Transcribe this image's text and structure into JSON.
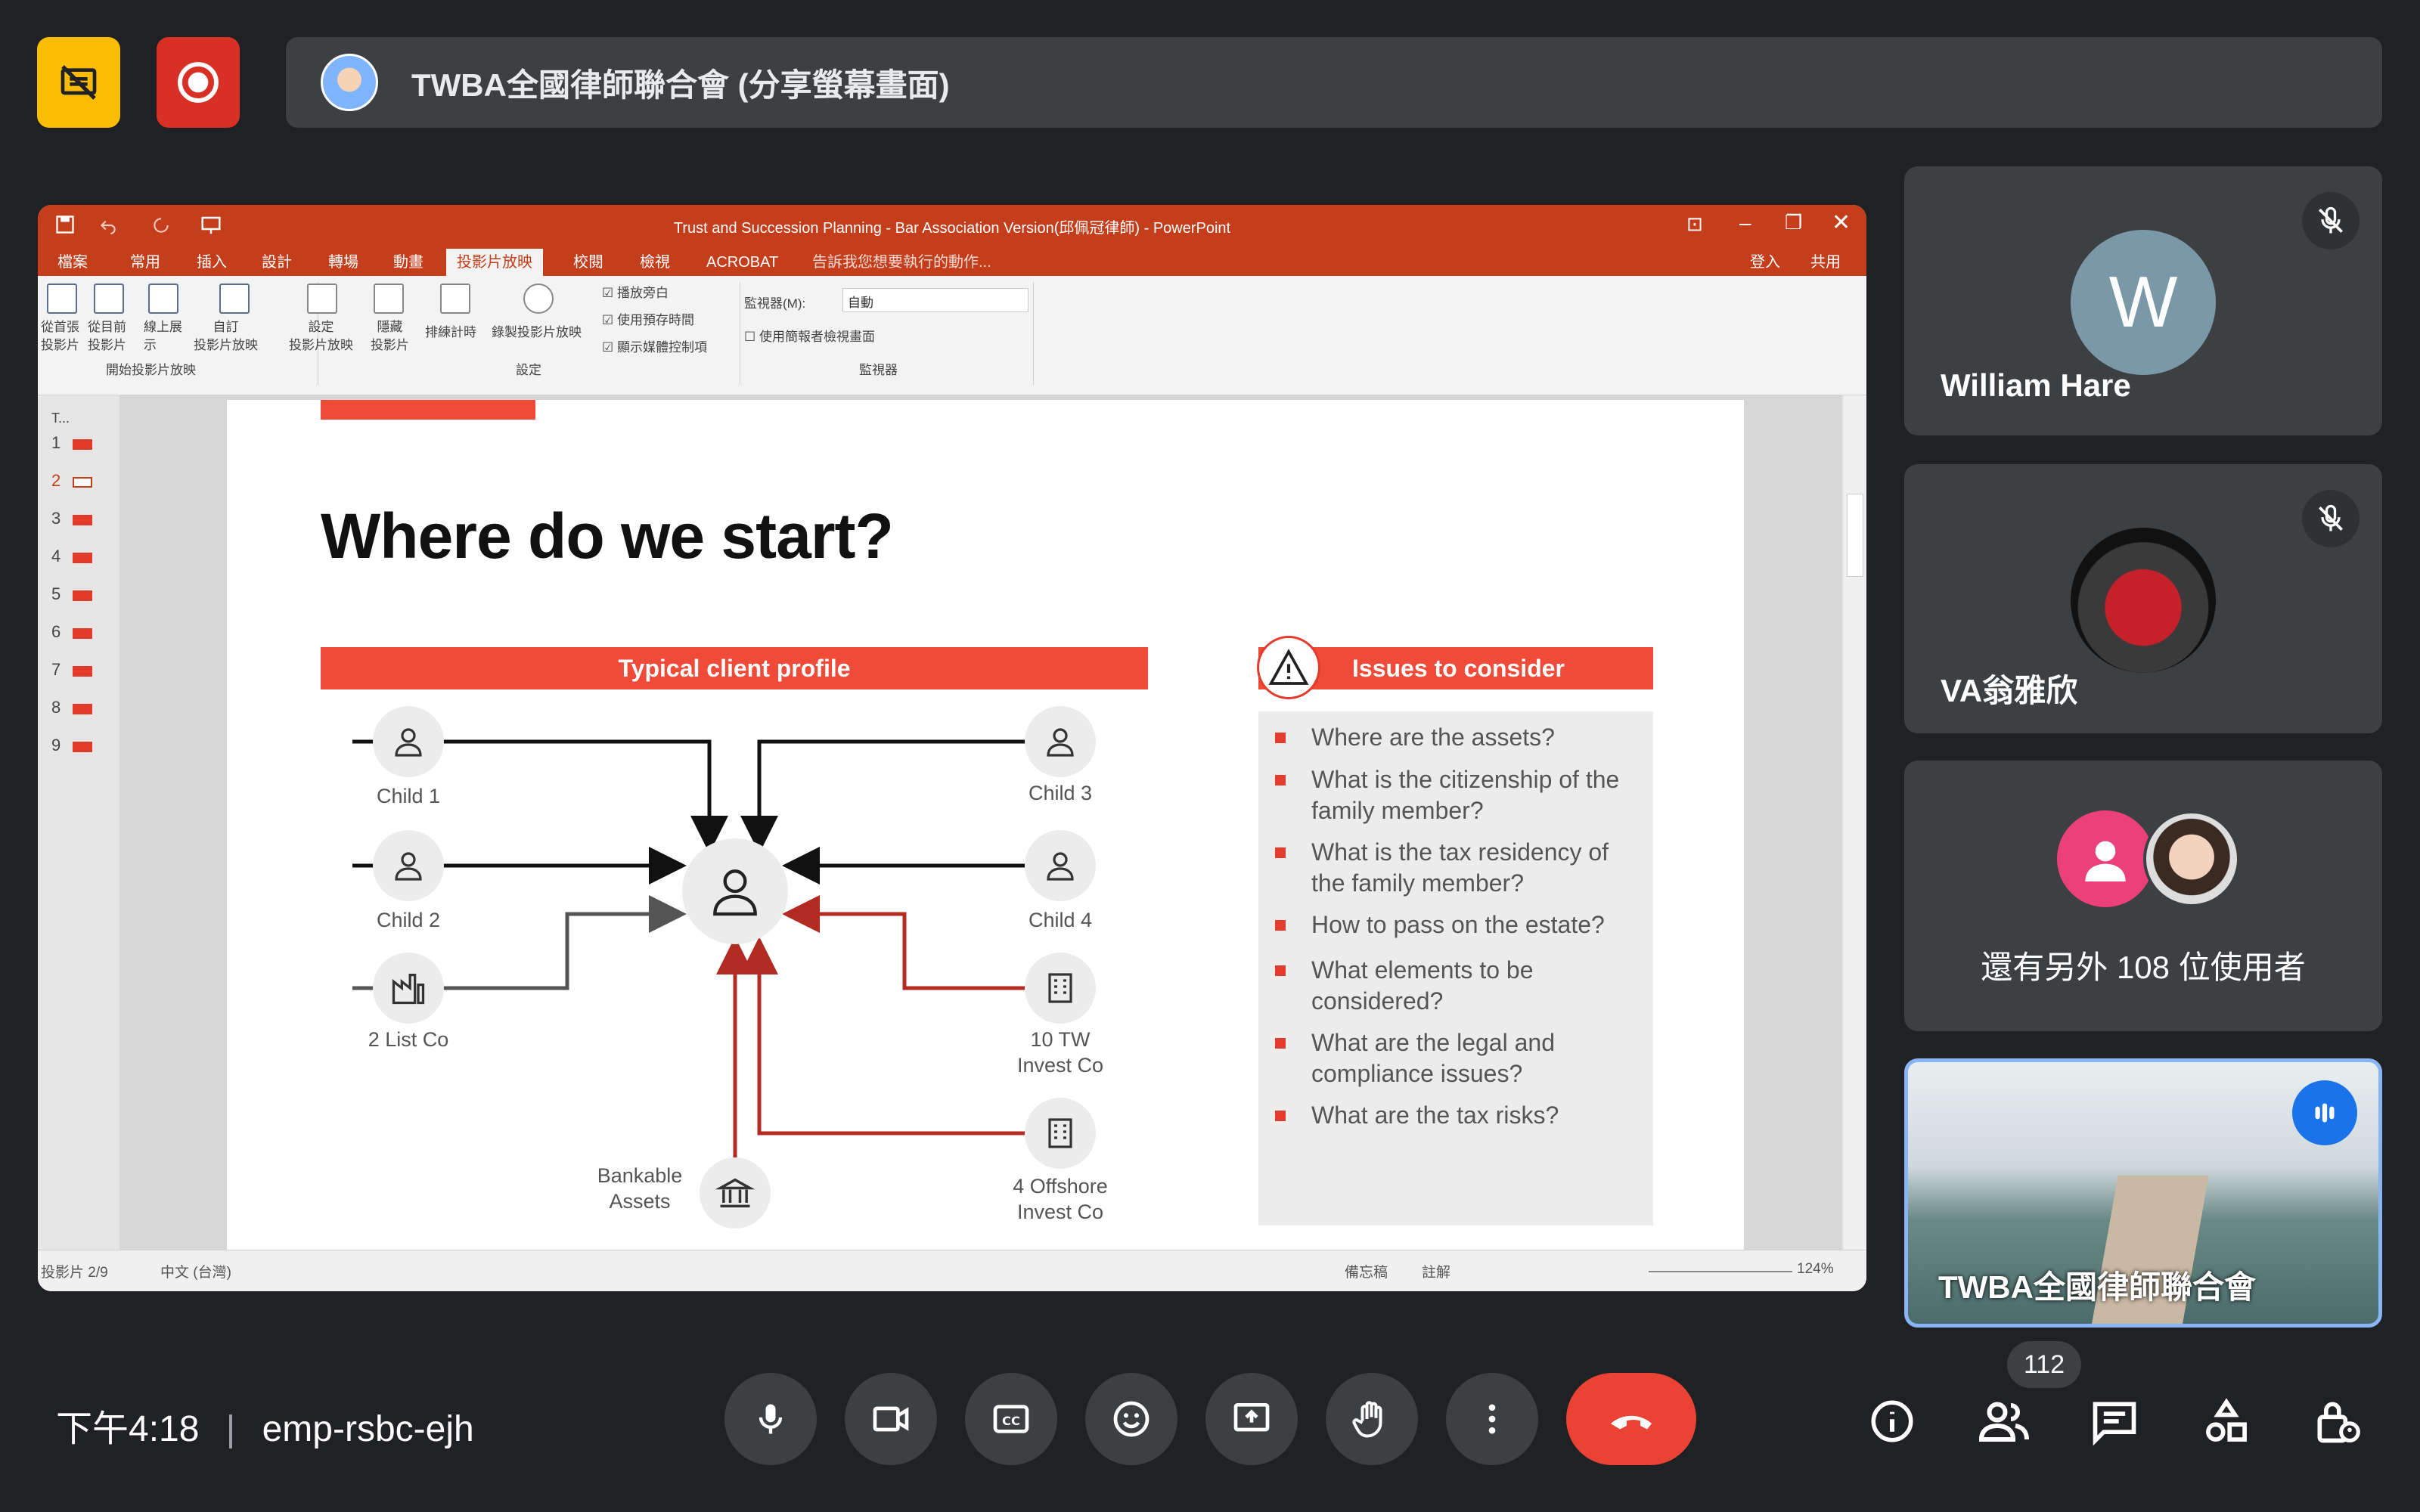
{
  "meeting": {
    "title": "TWBA全國律師聯合會 (分享螢幕畫面)",
    "time": "下午4:18",
    "code": "emp-rsbc-ejh",
    "participant_count": "112"
  },
  "ppt": {
    "window_title": "Trust and Succession Planning - Bar Association Version(邱佩冠律師) - PowerPoint",
    "tabs": [
      "檔案",
      "常用",
      "插入",
      "設計",
      "轉場",
      "動畫",
      "投影片放映",
      "校閱",
      "檢視",
      "ACROBAT"
    ],
    "active_tab": "投影片放映",
    "tell_me": "告訴我您想要執行的動作...",
    "sign_in": "登入",
    "share": "共用",
    "ribbon": {
      "from_beginning": "從首張\n投影片",
      "from_current": "從目前\n投影片",
      "online": "線上展\n示",
      "custom": "自訂\n投影片放映",
      "group_start": "開始投影片放映",
      "setup": "設定\n投影片放映",
      "hide": "隱藏\n投影片",
      "rehearse": "排練計時",
      "record": "錄製投影片放映",
      "group_setup": "設定",
      "play_narrations": "播放旁白",
      "use_timings": "使用預存時間",
      "show_media_controls": "顯示媒體控制項",
      "monitor_label": "監視器(M):",
      "monitor_value": "自動",
      "presenter_view": "使用簡報者檢視畫面",
      "group_monitors": "監視器"
    },
    "thumbnails": [
      "1",
      "2",
      "3",
      "4",
      "5",
      "6",
      "7",
      "8",
      "9"
    ],
    "outline_header": "T...",
    "status": {
      "slide_pos": "投影片 2/9",
      "language": "中文 (台灣)",
      "notes": "備忘稿",
      "comments": "註解",
      "zoom": "124%"
    }
  },
  "slide": {
    "heading": "Where do we start?",
    "profile_header": "Typical client profile",
    "issues_header": "Issues to consider",
    "nodes": {
      "child1": "Child 1",
      "child2": "Child 2",
      "list_co": "2 List Co",
      "child3": "Child 3",
      "child4": "Child 4",
      "tw_invest": "10 TW\nInvest Co",
      "offshore": "4 Offshore\nInvest Co",
      "bank": "Bankable\nAssets"
    },
    "issues": [
      "Where are the assets?",
      "What is the citizenship of the family member?",
      "What is the tax residency of the family member?",
      "How to pass on the estate?",
      "What elements to be considered?",
      "What are the legal and compliance issues?",
      "What are the tax risks?"
    ]
  },
  "tiles": {
    "william": {
      "initial": "W",
      "name": "William Hare"
    },
    "va": {
      "name": "VA翁雅欣"
    },
    "others": {
      "text": "還有另外 108 位使用者"
    },
    "room": {
      "name": "TWBA全國律師聯合會"
    }
  },
  "colors": {
    "accent_red": "#ea4335",
    "ppt_orange": "#c43e1c",
    "slide_red": "#f04a38",
    "tile_blue": "#8ab4f8",
    "yellow": "#fbbc04"
  }
}
